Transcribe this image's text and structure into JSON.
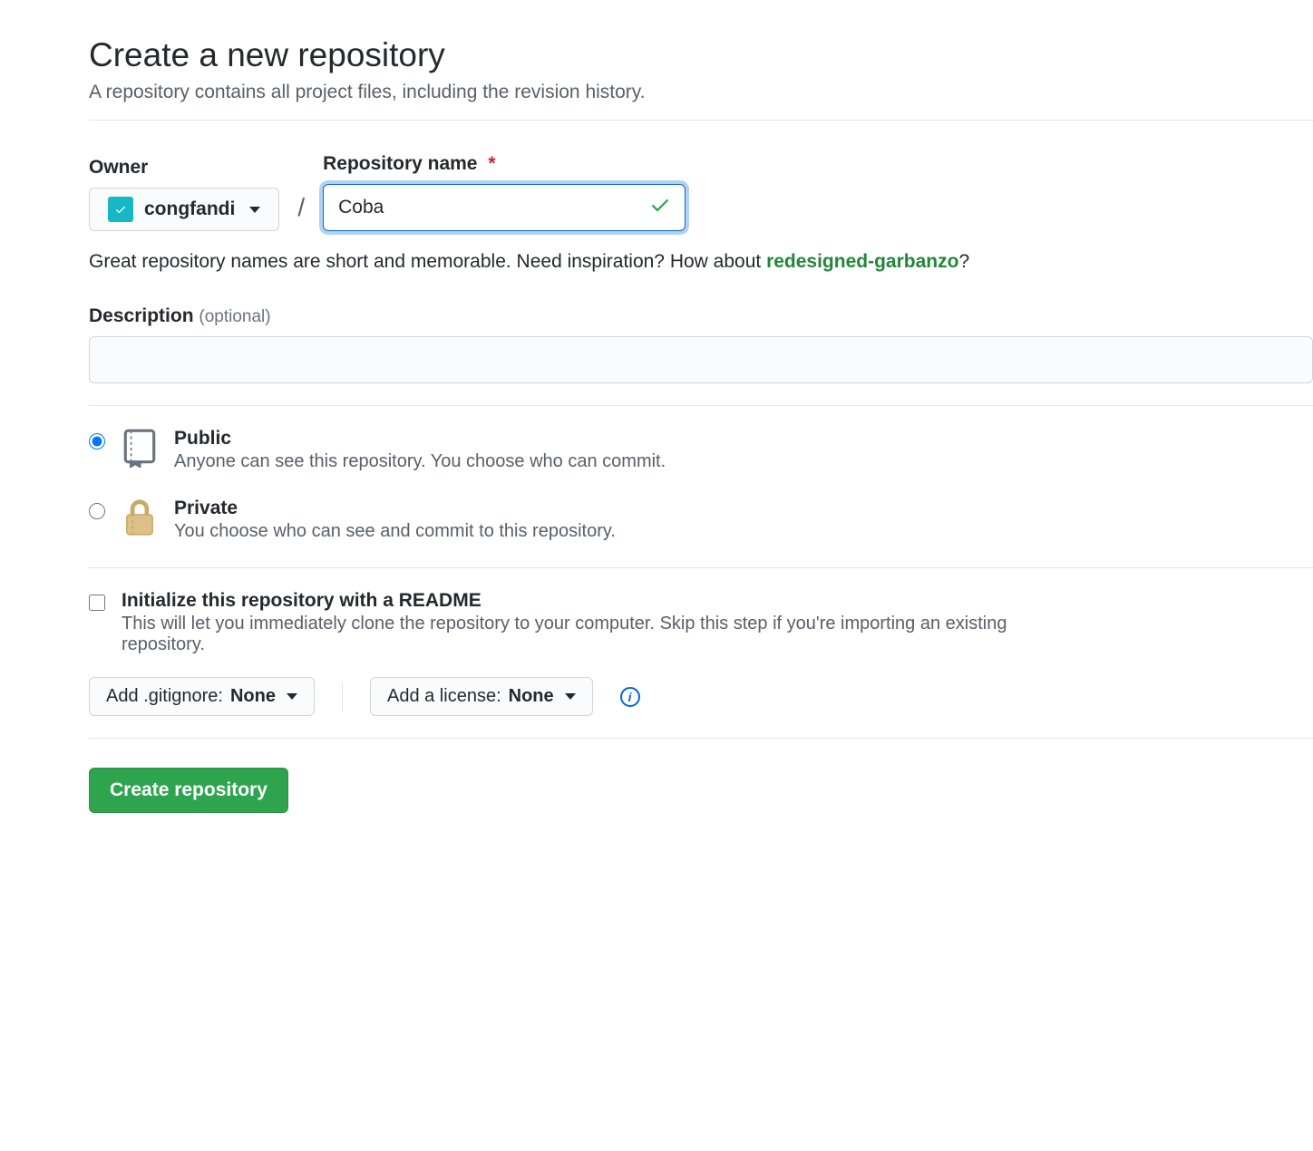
{
  "heading": "Create a new repository",
  "subtitle": "A repository contains all project files, including the revision history.",
  "labels": {
    "owner": "Owner",
    "repo_name": "Repository name",
    "description": "Description",
    "optional": "(optional)"
  },
  "owner": {
    "name": "congfandi"
  },
  "repo_name_value": "Coba",
  "helper": {
    "text1": "Great repository names are short and memorable. Need inspiration? How about ",
    "suggestion": "redesigned-garbanzo",
    "trailing": "?"
  },
  "visibility": {
    "public": {
      "title": "Public",
      "desc": "Anyone can see this repository. You choose who can commit."
    },
    "private": {
      "title": "Private",
      "desc": "You choose who can see and commit to this repository."
    }
  },
  "init": {
    "title": "Initialize this repository with a README",
    "desc": "This will let you immediately clone the repository to your computer. Skip this step if you're importing an existing repository."
  },
  "dropdowns": {
    "gitignore_prefix": "Add .gitignore: ",
    "gitignore_value": "None",
    "license_prefix": "Add a license: ",
    "license_value": "None"
  },
  "info_glyph": "i",
  "slash": "/",
  "create_button": "Create repository"
}
